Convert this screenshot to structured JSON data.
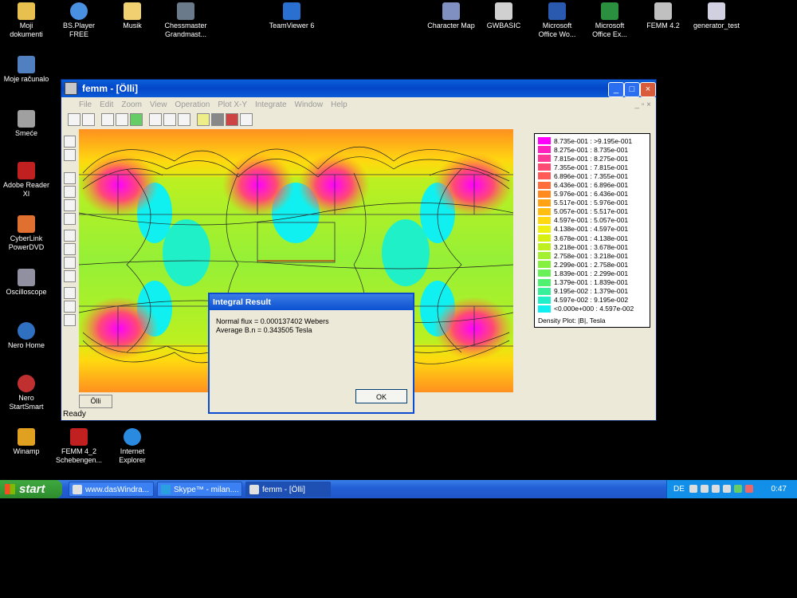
{
  "desktop_icons": [
    {
      "label": "Moji\ndokumenti",
      "color": "#e8c050"
    },
    {
      "label": "BS.Player\nFREE",
      "color": "#4a90e0"
    },
    {
      "label": "Musik",
      "color": "#f0d070"
    },
    {
      "label": "Chessmaster\nGrandmast...",
      "color": "#6a7a8a"
    },
    {
      "label": "TeamViewer 6",
      "color": "#2a70d0"
    },
    {
      "label": "Character Map",
      "color": "#8090c0"
    },
    {
      "label": "GWBASIC",
      "color": "#d0d0d0"
    },
    {
      "label": "Microsoft\nOffice Wo...",
      "color": "#2a5ab0"
    },
    {
      "label": "Microsoft\nOffice Ex...",
      "color": "#2a9040"
    },
    {
      "label": "FEMM 4.2",
      "color": "#c0c0c0"
    },
    {
      "label": "generator_test",
      "color": "#d0d0e0"
    },
    {
      "label": "Moje računalo",
      "color": "#5080c0"
    },
    {
      "label": "Smeće",
      "color": "#a0a0a0"
    },
    {
      "label": "Adobe Reader\nXI",
      "color": "#c02020"
    },
    {
      "label": "CyberLink\nPowerDVD",
      "color": "#e07030"
    },
    {
      "label": "Oscilloscope",
      "color": "#9090a0"
    },
    {
      "label": "Nero Home",
      "color": "#3070c0"
    },
    {
      "label": "Nero\nStartSmart",
      "color": "#c03030"
    },
    {
      "label": "Winamp",
      "color": "#e0a020"
    },
    {
      "label": "FEMM 4_2\nSchebengen...",
      "color": "#c02020"
    },
    {
      "label": "Internet\nExplorer",
      "color": "#2a8ae0"
    }
  ],
  "window": {
    "title": "femm - [Ölli]",
    "menu": [
      "File",
      "Edit",
      "Zoom",
      "View",
      "Operation",
      "Plot X-Y",
      "Integrate",
      "Window",
      "Help"
    ],
    "mdi_controls": "_ ▫ ×",
    "doc_tab": "Ölli",
    "status": "Ready"
  },
  "legend": {
    "rows": [
      {
        "text": "8.735e-001 : >9.195e-001",
        "color": "#ff00ff"
      },
      {
        "text": "8.275e-001 : 8.735e-001",
        "color": "#ff20c0"
      },
      {
        "text": "7.815e-001 : 8.275e-001",
        "color": "#ff3a96"
      },
      {
        "text": "7.355e-001 : 7.815e-001",
        "color": "#ff4a74"
      },
      {
        "text": "6.896e-001 : 7.355e-001",
        "color": "#ff5a58"
      },
      {
        "text": "6.436e-001 : 6.896e-001",
        "color": "#ff6e3a"
      },
      {
        "text": "5.976e-001 : 6.436e-001",
        "color": "#ff8a20"
      },
      {
        "text": "5.517e-001 : 5.976e-001",
        "color": "#ffa214"
      },
      {
        "text": "5.057e-001 : 5.517e-001",
        "color": "#ffbe10"
      },
      {
        "text": "4.597e-001 : 5.057e-001",
        "color": "#ffd810"
      },
      {
        "text": "4.138e-001 : 4.597e-001",
        "color": "#f0f010"
      },
      {
        "text": "3.678e-001 : 4.138e-001",
        "color": "#d8f010"
      },
      {
        "text": "3.218e-001 : 3.678e-001",
        "color": "#bef020"
      },
      {
        "text": "2.758e-001 : 3.218e-001",
        "color": "#a2f030"
      },
      {
        "text": "2.299e-001 : 2.758e-001",
        "color": "#86f040"
      },
      {
        "text": "1.839e-001 : 2.299e-001",
        "color": "#6af058"
      },
      {
        "text": "1.379e-001 : 1.839e-001",
        "color": "#50f070"
      },
      {
        "text": "9.195e-002 : 1.379e-001",
        "color": "#38f09a"
      },
      {
        "text": "4.597e-002 : 9.195e-002",
        "color": "#20f0c8"
      },
      {
        "text": "<0.000e+000 : 4.597e-002",
        "color": "#10f0f0"
      }
    ],
    "title": "Density Plot: |B|, Tesla"
  },
  "dialog": {
    "title": "Integral Result",
    "line1": "Normal flux = 0.000137402 Webers",
    "line2": "Average B.n = 0.343505 Tesla",
    "ok": "OK"
  },
  "taskbar": {
    "start": "start",
    "tasks": [
      "www.dasWindra...",
      "Skype™ - milan....",
      "femm - [Ölli]"
    ],
    "lang": "DE",
    "clock": "0:47"
  }
}
